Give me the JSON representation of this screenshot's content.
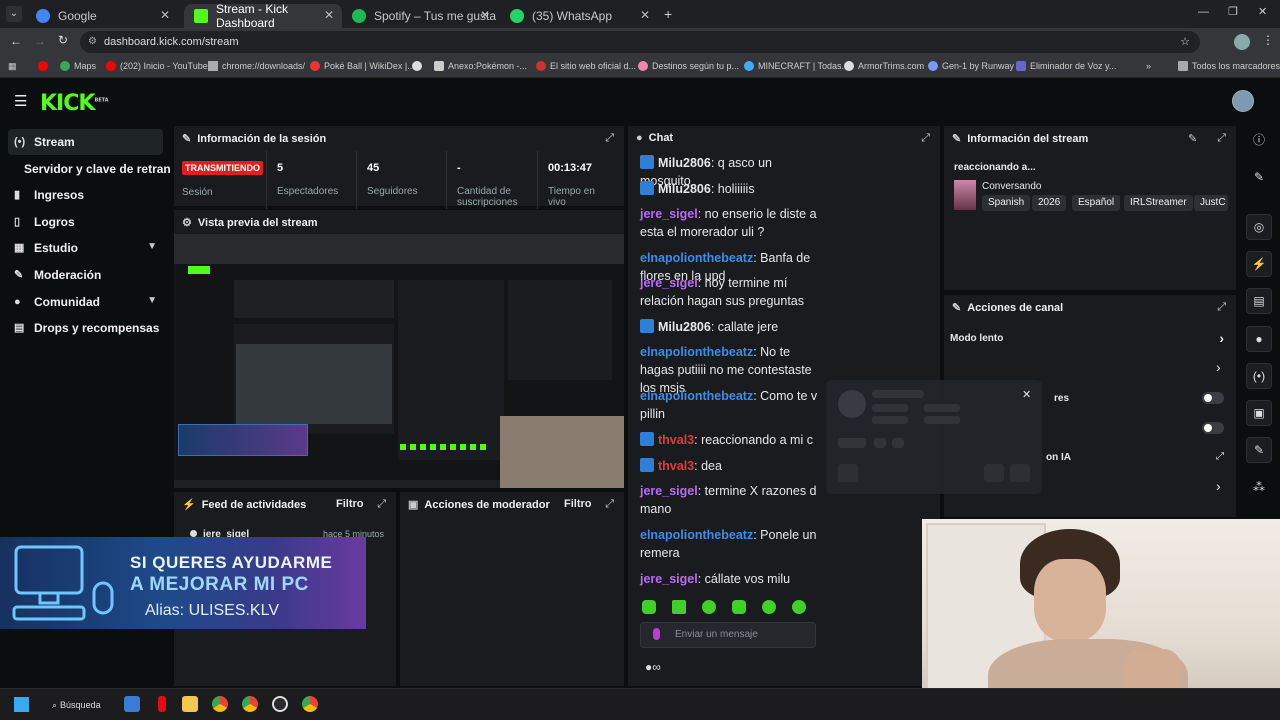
{
  "browser": {
    "tabs": [
      {
        "title": "Google",
        "color": "#4285f4"
      },
      {
        "title": "Stream - Kick Dashboard",
        "color": "#53fc18"
      },
      {
        "title": "Spotify – Tus me gusta",
        "color": "#1db954"
      },
      {
        "title": "(35) WhatsApp",
        "color": "#25d366"
      }
    ],
    "url": "dashboard.kick.com/stream",
    "bookmarks": [
      "Maps",
      "(202) Inicio - YouTube",
      "chrome://downloads/",
      "Poké Ball | WikiDex |...",
      "Anexo:Pokémon -...",
      "El sitio web oficial d...",
      "Destinos según tu p...",
      "MINECRAFT | Todas...",
      "ArmorTrims.com",
      "Gen-1 by Runway",
      "Eliminador de Voz y...",
      "Todos los marcadores"
    ]
  },
  "header": {
    "logo": "KICK",
    "beta": "BETA"
  },
  "sidebar": {
    "items": [
      {
        "label": "Stream"
      },
      {
        "label": "Servidor y clave de retransmisión"
      },
      {
        "label": "Ingresos"
      },
      {
        "label": "Logros"
      },
      {
        "label": "Estudio"
      },
      {
        "label": "Moderación"
      },
      {
        "label": "Comunidad"
      },
      {
        "label": "Drops y recompensas"
      }
    ]
  },
  "session": {
    "title": "Información de la sesión",
    "live_badge": "TRANSMITIENDO",
    "session_label": "Sesión",
    "stats": [
      {
        "value": "5",
        "label": "Espectadores"
      },
      {
        "value": "45",
        "label": "Seguidores"
      },
      {
        "value": "-",
        "label": "Cantidad de suscripciones"
      },
      {
        "value": "00:13:47",
        "label": "Tiempo en vivo"
      }
    ]
  },
  "preview": {
    "title": "Vista previa del stream"
  },
  "activity": {
    "title": "Feed de actividades",
    "filter": "Filtro",
    "item_user": "jere_sigel",
    "item_time": "hace 5 minutos"
  },
  "modactions": {
    "title": "Acciones de moderador",
    "filter": "Filtro"
  },
  "overlay": {
    "line1": "SI QUERES AYUDARME",
    "line2": "A MEJORAR MI PC",
    "line3": "Alias: ULISES.KLV"
  },
  "chat": {
    "title": "Chat",
    "placeholder": "Enviar un mensaje",
    "messages": [
      {
        "user": "Milu2806",
        "text": "q asco un mosquito",
        "color": "#e8e8e8",
        "badge": true
      },
      {
        "user": "Milu2806",
        "text": "holiiiiis",
        "color": "#e8e8e8",
        "badge": true
      },
      {
        "user": "jere_sigel",
        "text": "no enserio le diste a esta el morerador uli ?",
        "color": "#b86cf0",
        "badge": false
      },
      {
        "user": "elnapolionthebeatz",
        "text": "Banfa de flores en la upd",
        "color": "#3b8ee8",
        "badge": false
      },
      {
        "user": "jere_sigel",
        "text": "hoy termine mí relación hagan sus preguntas",
        "color": "#b86cf0",
        "badge": false
      },
      {
        "user": "Milu2806",
        "text": "callate jere",
        "color": "#e8e8e8",
        "badge": true
      },
      {
        "user": "elnapolionthebeatz",
        "text": "No te hagas putiiii no me contestaste los msjs",
        "color": "#3b8ee8",
        "badge": false
      },
      {
        "user": "elnapolionthebeatz",
        "text": "Como te v pillin",
        "color": "#3b8ee8",
        "badge": false
      },
      {
        "user": "thval3",
        "text": "reaccionando a mi c",
        "color": "#e53a3a",
        "badge": true
      },
      {
        "user": "thval3",
        "text": "dea",
        "color": "#e53a3a",
        "badge": true
      },
      {
        "user": "jere_sigel",
        "text": "termine X razones d mano",
        "color": "#b86cf0",
        "badge": false
      },
      {
        "user": "elnapolionthebeatz",
        "text": "Ponele un remera",
        "color": "#3b8ee8",
        "badge": false
      },
      {
        "user": "jere_sigel",
        "text": "cállate vos milu",
        "color": "#b86cf0",
        "badge": false
      }
    ]
  },
  "streaminfo": {
    "title": "Información del stream",
    "stream_title": "reaccionando a...",
    "category": "Conversando",
    "tags": [
      "Spanish",
      "2026",
      "Español",
      "IRLStreamer",
      "JustC"
    ]
  },
  "channel": {
    "title": "Acciones de canal",
    "slow_mode": "Modo lento",
    "partial1": "res",
    "partial2": "on IA"
  },
  "taskbar": {
    "search": "Búsqueda"
  }
}
